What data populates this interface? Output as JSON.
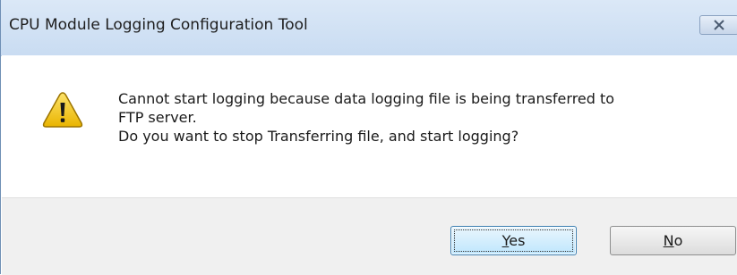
{
  "window": {
    "title": "CPU Module Logging Configuration Tool",
    "close_icon": "close-x-icon"
  },
  "dialog": {
    "icon": "warning-triangle-icon",
    "icon_color": "#f4c400",
    "message_lines": [
      "Cannot start logging because data logging file is being transferred to",
      "FTP server.",
      "Do you want to stop Transferring file, and start logging?"
    ]
  },
  "buttons": {
    "yes": {
      "mnemonic": "Y",
      "rest": "es"
    },
    "no": {
      "mnemonic": "N",
      "rest": "o"
    }
  }
}
